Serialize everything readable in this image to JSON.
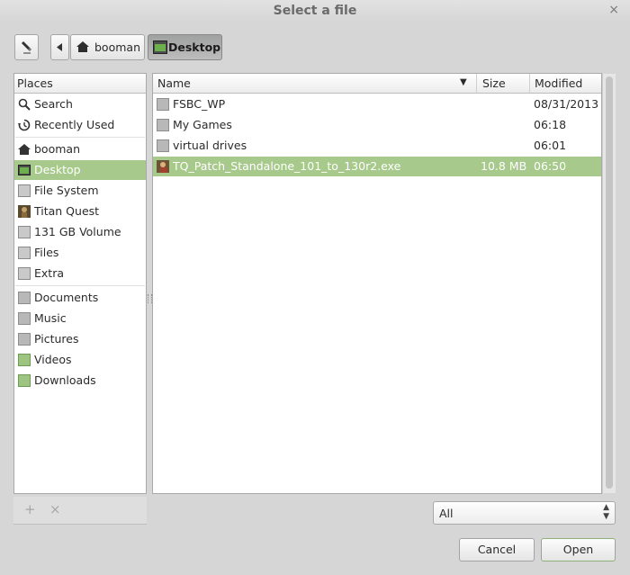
{
  "window": {
    "title": "Select a file",
    "close_glyph": "×"
  },
  "pathbar": {
    "crumbs": [
      {
        "label": "booman",
        "icon": "home-icon"
      },
      {
        "label": "Desktop",
        "icon": "desktop-icon",
        "active": true
      }
    ]
  },
  "places": {
    "header": "Places",
    "items": [
      {
        "label": "Search",
        "icon": "search-icon"
      },
      {
        "label": "Recently Used",
        "icon": "recent-icon"
      },
      {
        "label": "booman",
        "icon": "home-icon"
      },
      {
        "label": "Desktop",
        "icon": "desktop-icon",
        "selected": true
      },
      {
        "label": "File System",
        "icon": "drive-icon"
      },
      {
        "label": "Titan Quest",
        "icon": "titan-quest-icon"
      },
      {
        "label": "131 GB Volume",
        "icon": "drive-icon"
      },
      {
        "label": "Files",
        "icon": "drive-icon"
      },
      {
        "label": "Extra",
        "icon": "drive-icon"
      },
      {
        "label": "Documents",
        "icon": "folder-documents-icon"
      },
      {
        "label": "Music",
        "icon": "folder-music-icon"
      },
      {
        "label": "Pictures",
        "icon": "folder-pictures-icon"
      },
      {
        "label": "Videos",
        "icon": "folder-videos-icon"
      },
      {
        "label": "Downloads",
        "icon": "folder-downloads-icon"
      }
    ],
    "add_glyph": "+",
    "remove_glyph": "×"
  },
  "files": {
    "columns": {
      "name": "Name",
      "size": "Size",
      "modified": "Modified"
    },
    "sort_indicator": "▼",
    "rows": [
      {
        "name": "FSBC_WP",
        "size": "",
        "modified": "08/31/2013",
        "icon": "folder-icon"
      },
      {
        "name": "My Games",
        "size": "",
        "modified": "06:18",
        "icon": "folder-icon"
      },
      {
        "name": "virtual drives",
        "size": "",
        "modified": "06:01",
        "icon": "folder-icon"
      },
      {
        "name": "TQ_Patch_Standalone_101_to_130r2.exe",
        "size": "10.8 MB",
        "modified": "06:50",
        "icon": "exe-icon",
        "selected": true
      }
    ]
  },
  "filter": {
    "value": "All"
  },
  "buttons": {
    "cancel": "Cancel",
    "open": "Open"
  },
  "colors": {
    "selection": "#a7c98b",
    "background": "#d6d6d6"
  }
}
